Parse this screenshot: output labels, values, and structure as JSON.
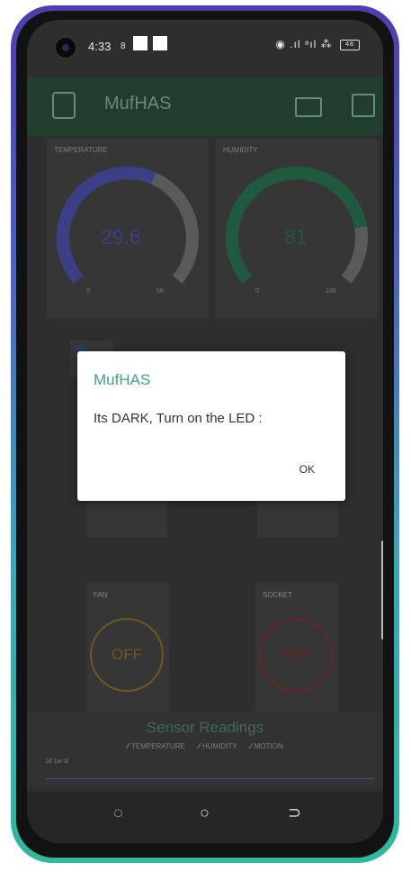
{
  "statusbar": {
    "time": "4:33",
    "indicator": "8",
    "icons": "◉ .ıl ᵊıl ⁂",
    "battery": "48"
  },
  "appbar": {
    "title": "MufHAS",
    "left_icon": "device-icon",
    "mid_icon": "battery-widget-icon",
    "right_icon": "square-icon",
    "color": "#1f3e2e"
  },
  "gauges": [
    {
      "label": "TEMPERATURE",
      "value": "29.6",
      "min": "0",
      "max": "50",
      "fraction": 0.59,
      "color": "#3a3f86"
    },
    {
      "label": "HUMIDITY",
      "value": "81",
      "min": "0",
      "max": "100",
      "fraction": 0.81,
      "color": "#1f5a3e"
    }
  ],
  "controls": {
    "fan": {
      "label": "FAN",
      "state": "OFF",
      "color": "#6a5a1e"
    },
    "socket": {
      "label": "SOCKET",
      "state": "OFF",
      "color": "#6a2626"
    }
  },
  "readings": {
    "title": "Sensor Readings",
    "legend": [
      "TEMPERATURE",
      "HUMIDITY",
      "MOTION"
    ],
    "range": "1d  1w  3l"
  },
  "navbar": {
    "recents": "◌",
    "home": "○",
    "back": "⊃"
  },
  "dialog": {
    "title": "MufHAS",
    "message": "Its DARK, Turn on the LED :",
    "ok": "OK"
  }
}
